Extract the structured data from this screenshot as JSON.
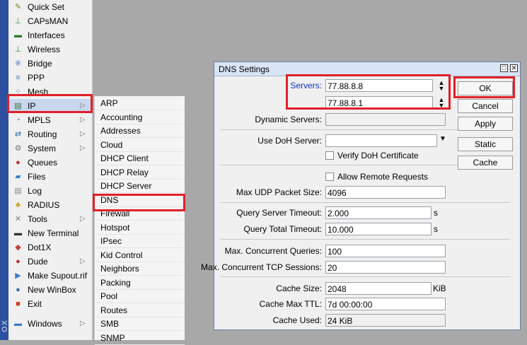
{
  "side_strip": {
    "text": "OX"
  },
  "menu": {
    "items": [
      {
        "label": "Quick Set",
        "icon": "wand-icon",
        "glyph": "✎",
        "color": "#6b8e23",
        "arrow": ""
      },
      {
        "label": "CAPsMAN",
        "icon": "antenna-icon",
        "glyph": "⊥",
        "color": "#2f8a3d",
        "arrow": ""
      },
      {
        "label": "Interfaces",
        "icon": "interface-icon",
        "glyph": "▬",
        "color": "#2f7a2f",
        "arrow": ""
      },
      {
        "label": "Wireless",
        "icon": "wireless-icon",
        "glyph": "⊥",
        "color": "#2f8a3d",
        "arrow": ""
      },
      {
        "label": "Bridge",
        "icon": "bridge-icon",
        "glyph": "⁜",
        "color": "#3a6fb0",
        "arrow": ""
      },
      {
        "label": "PPP",
        "icon": "ppp-icon",
        "glyph": "≡",
        "color": "#4a7ab0",
        "arrow": ""
      },
      {
        "label": "Mesh",
        "icon": "mesh-icon",
        "glyph": "⁘",
        "color": "#3a6fb0",
        "arrow": ""
      },
      {
        "label": "IP",
        "icon": "ip-icon",
        "glyph": "▤",
        "color": "#2f6f3a",
        "arrow": "▷"
      },
      {
        "label": "MPLS",
        "icon": "mpls-icon",
        "glyph": "◔",
        "color": "#5a7fb0",
        "arrow": "▷"
      },
      {
        "label": "Routing",
        "icon": "routing-icon",
        "glyph": "⇄",
        "color": "#3a6fb0",
        "arrow": "▷"
      },
      {
        "label": "System",
        "icon": "system-icon",
        "glyph": "⚙",
        "color": "#777777",
        "arrow": "▷"
      },
      {
        "label": "Queues",
        "icon": "queues-icon",
        "glyph": "●",
        "color": "#c03030",
        "arrow": ""
      },
      {
        "label": "Files",
        "icon": "folder-icon",
        "glyph": "▰",
        "color": "#3a7fc8",
        "arrow": ""
      },
      {
        "label": "Log",
        "icon": "log-icon",
        "glyph": "▤",
        "color": "#888888",
        "arrow": ""
      },
      {
        "label": "RADIUS",
        "icon": "radius-icon",
        "glyph": "♣",
        "color": "#c8a020",
        "arrow": ""
      },
      {
        "label": "Tools",
        "icon": "tools-icon",
        "glyph": "✕",
        "color": "#7a7a7a",
        "arrow": "▷"
      },
      {
        "label": "New Terminal",
        "icon": "terminal-icon",
        "glyph": "▬",
        "color": "#333333",
        "arrow": ""
      },
      {
        "label": "Dot1X",
        "icon": "dot1x-icon",
        "glyph": "◆",
        "color": "#c04040",
        "arrow": ""
      },
      {
        "label": "Dude",
        "icon": "dude-icon",
        "glyph": "●",
        "color": "#c03030",
        "arrow": "▷"
      },
      {
        "label": "Make Supout.rif",
        "icon": "supout-icon",
        "glyph": "▶",
        "color": "#3a7fc8",
        "arrow": ""
      },
      {
        "label": "New WinBox",
        "icon": "winbox-icon",
        "glyph": "●",
        "color": "#3a6fb0",
        "arrow": ""
      },
      {
        "label": "Exit",
        "icon": "exit-icon",
        "glyph": "■",
        "color": "#d04020",
        "arrow": ""
      },
      {
        "label": "",
        "icon": "",
        "glyph": "",
        "color": "#000000",
        "arrow": ""
      },
      {
        "label": "Windows",
        "icon": "windows-icon",
        "glyph": "▬",
        "color": "#3a7fc8",
        "arrow": "▷"
      }
    ]
  },
  "submenu": {
    "items": [
      "ARP",
      "Accounting",
      "Addresses",
      "Cloud",
      "DHCP Client",
      "DHCP Relay",
      "DHCP Server",
      "DNS",
      "Firewall",
      "Hotspot",
      "IPsec",
      "Kid Control",
      "Neighbors",
      "Packing",
      "Pool",
      "Routes",
      "SMB",
      "SNMP"
    ]
  },
  "dialog": {
    "title": "DNS Settings",
    "servers_label": "Servers:",
    "server1": "77.88.8.8",
    "server2": "77.88.8.1",
    "dynamic_servers_label": "Dynamic Servers:",
    "dynamic_servers_value": "",
    "use_doh_label": "Use DoH Server:",
    "use_doh_value": "",
    "verify_doh_label": "Verify DoH Certificate",
    "allow_remote_label": "Allow Remote Requests",
    "max_udp_label": "Max UDP Packet Size:",
    "max_udp_value": "4096",
    "query_server_timeout_label": "Query Server Timeout:",
    "query_server_timeout_value": "2.000",
    "query_total_timeout_label": "Query Total Timeout:",
    "query_total_timeout_value": "10.000",
    "seconds_unit": "s",
    "max_concurrent_queries_label": "Max. Concurrent Queries:",
    "max_concurrent_queries_value": "100",
    "max_concurrent_tcp_label": "Max. Concurrent TCP Sessions:",
    "max_concurrent_tcp_value": "20",
    "cache_size_label": "Cache Size:",
    "cache_size_value": "2048",
    "cache_size_unit": "KiB",
    "cache_max_ttl_label": "Cache Max TTL:",
    "cache_max_ttl_value": "7d 00:00:00",
    "cache_used_label": "Cache Used:",
    "cache_used_value": "24 KiB",
    "buttons": {
      "ok": "OK",
      "cancel": "Cancel",
      "apply": "Apply",
      "static": "Static",
      "cache": "Cache"
    }
  },
  "colors": {
    "highlight": "#e0202a",
    "servers_label": "#1030c0"
  }
}
